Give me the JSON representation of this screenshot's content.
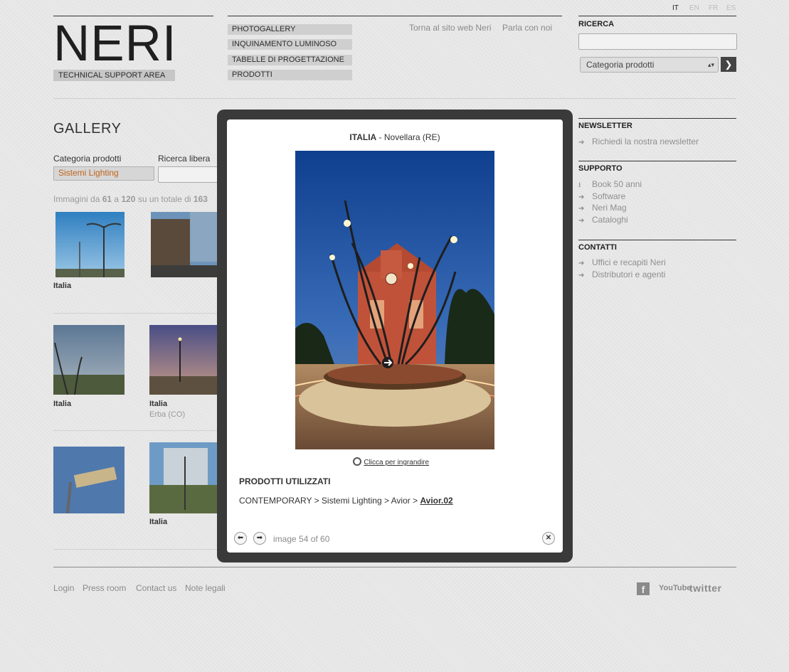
{
  "languages": [
    "IT",
    "EN",
    "FR",
    "ES"
  ],
  "logo": {
    "brand": "NERI",
    "subtitle": "TECHNICAL SUPPORT AREA"
  },
  "nav": [
    "PHOTOGALLERY",
    "INQUINAMENTO LUMINOSO",
    "TABELLE DI PROGETTAZIONE",
    "PRODOTTI"
  ],
  "top_links": [
    "Torna al sito web Neri",
    "Parla con noi"
  ],
  "search": {
    "heading": "RICERCA",
    "value": "",
    "category_select": "Categoria prodotti"
  },
  "sidebar": {
    "newsletter": {
      "heading": "NEWSLETTER",
      "items": [
        "Richiedi la nostra newsletter"
      ]
    },
    "supporto": {
      "heading": "SUPPORTO",
      "items": [
        "Book 50 anni",
        "Software",
        "Neri Mag",
        "Cataloghi"
      ]
    },
    "contatti": {
      "heading": "CONTATTI",
      "items": [
        "Uffici e recapiti Neri",
        "Distributori e agenti"
      ]
    }
  },
  "gallery": {
    "title": "GALLERY",
    "filter_category_label": "Categoria prodotti",
    "filter_category_value": "Sistemi Lighting",
    "filter_search_label": "Ricerca libera",
    "range_prefix": "Immagini da",
    "range_from": "61",
    "range_mid": "a",
    "range_to": "120",
    "range_total_prefix": "su un totale di",
    "range_total": "163",
    "items": [
      {
        "caption": "Italia",
        "sub": ""
      },
      {
        "caption": "",
        "sub": ""
      },
      {
        "caption": "Italia",
        "sub": ""
      },
      {
        "caption": "Italia",
        "sub": "Erba (CO)"
      },
      {
        "caption": "",
        "sub": ""
      },
      {
        "caption": "Italia",
        "sub": ""
      }
    ]
  },
  "modal": {
    "country": "ITALIA",
    "separator": " - ",
    "place": "Novellara (RE)",
    "zoom_label": "Clicca per ingrandire",
    "products_heading": "PRODOTTI UTILIZZATI",
    "breadcrumb": "CONTEMPORARY > Sistemi Lighting > Avior > ",
    "product_link": "Avior.02",
    "counter": "image 54 of 60"
  },
  "footer": {
    "links": [
      "Login",
      "Press room",
      "Contact us",
      "Note legali"
    ],
    "social": [
      "facebook-icon",
      "youtube-icon",
      "twitter-icon"
    ],
    "social_labels": [
      "f",
      "YouTube",
      "twitter"
    ]
  },
  "colors": {
    "accent_orange": "#c0641a",
    "overlay": "#3a3a3a"
  }
}
